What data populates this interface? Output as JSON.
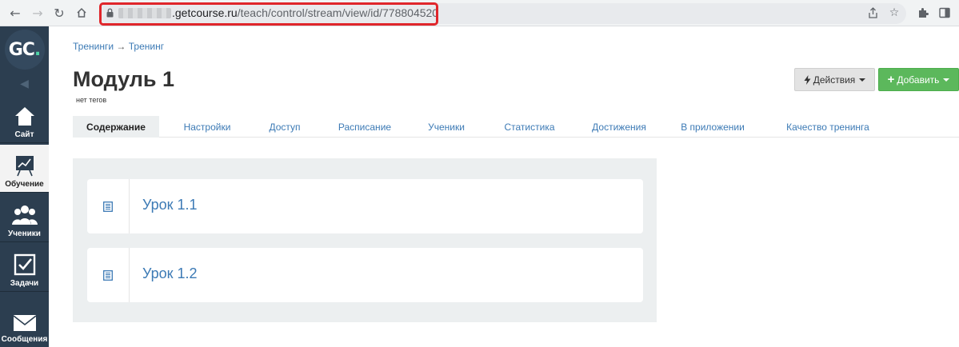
{
  "browser": {
    "url_domain": ".getcourse.ru",
    "url_path": "/teach/control/stream/view/id/778804520",
    "back_icon": "arrow-left-icon",
    "forward_icon": "arrow-right-icon",
    "reload_icon": "reload-icon",
    "home_icon": "home-icon"
  },
  "sidebar": {
    "logo_text": "GC",
    "logo_dot": ".",
    "items": [
      {
        "label": "Сайт",
        "icon": "house-icon"
      },
      {
        "label": "Обучение",
        "icon": "chart-board-icon",
        "active": true
      },
      {
        "label": "Ученики",
        "icon": "users-icon"
      },
      {
        "label": "Задачи",
        "icon": "checkbox-icon"
      },
      {
        "label": "Сообщения",
        "icon": "envelope-icon"
      }
    ]
  },
  "breadcrumb": {
    "first": "Тренинги",
    "separator": "→",
    "second": "Тренинг"
  },
  "page": {
    "title": "Модуль 1",
    "tags": "нет тегов"
  },
  "buttons": {
    "actions_label": "Действия",
    "add_label": "Добавить",
    "add_prefix": "+"
  },
  "tabs": [
    {
      "label": "Содержание",
      "active": true
    },
    {
      "label": "Настройки"
    },
    {
      "label": "Доступ"
    },
    {
      "label": "Расписание"
    },
    {
      "label": "Ученики"
    },
    {
      "label": "Статистика"
    },
    {
      "label": "Достижения"
    },
    {
      "label": "В приложении"
    },
    {
      "label": "Качество тренинга"
    }
  ],
  "lessons": [
    {
      "title": "Урок 1.1",
      "icon": "document-icon"
    },
    {
      "title": "Урок 1.2",
      "icon": "document-icon"
    }
  ],
  "colors": {
    "sidebar": "#2c3e50",
    "link": "#3c7ab5",
    "add_button": "#5cb85c",
    "url_highlight": "#e0262b"
  }
}
